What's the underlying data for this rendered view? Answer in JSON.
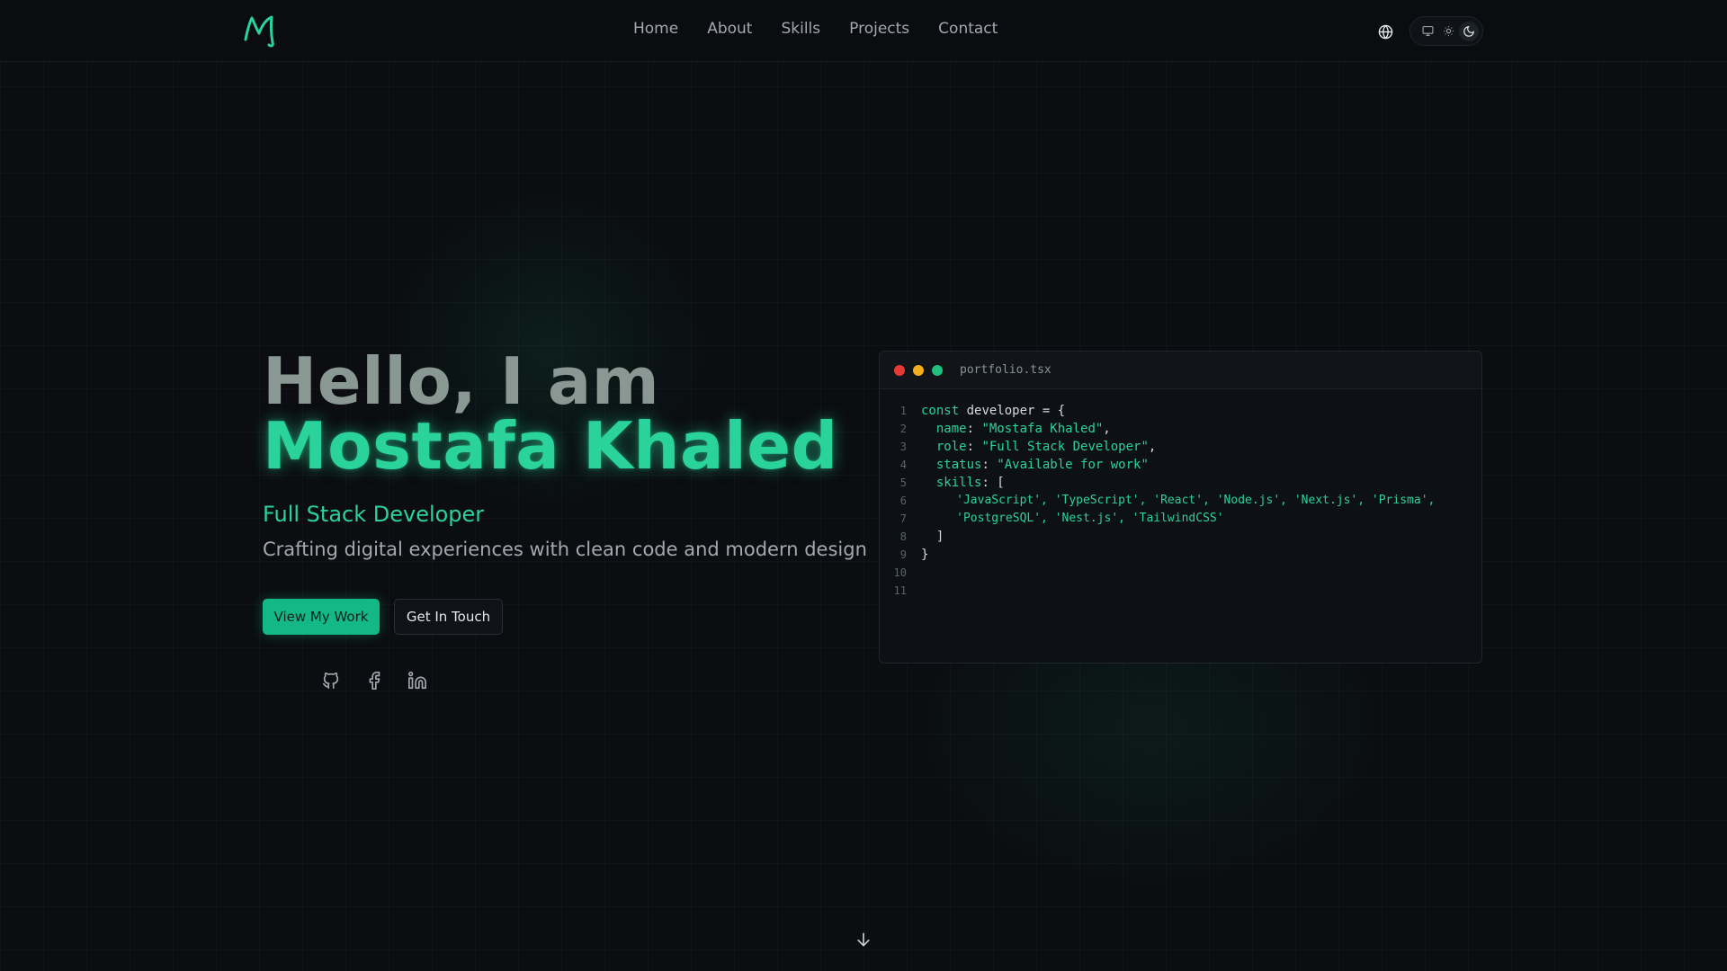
{
  "nav": {
    "links": [
      "Home",
      "About",
      "Skills",
      "Projects",
      "Contact"
    ]
  },
  "hero": {
    "greeting": "Hello, I am",
    "name": "Mostafa Khaled",
    "role": "Full Stack Developer",
    "tagline": "Crafting digital experiences with clean code and modern design",
    "primary_button": "View My Work",
    "secondary_button": "Get In Touch"
  },
  "socials": [
    "github-icon",
    "facebook-icon",
    "linkedin-icon"
  ],
  "code": {
    "filename": "portfolio.tsx",
    "line_numbers": [
      "1",
      "2",
      "3",
      "4",
      "5",
      "6",
      "7",
      "8",
      "9",
      "10",
      "11"
    ],
    "kw_const": "const",
    "var_name": " developer = {",
    "name_key": "  name",
    "name_val": "\"Mostafa Khaled\"",
    "role_key": "  role",
    "role_val": "\"Full Stack Developer\"",
    "status_key": "  status",
    "status_val": "\"Available for work\"",
    "skills_key": "  skills",
    "skills_open": ": [",
    "skills_line1": "     'JavaScript', 'TypeScript', 'React', 'Node.js', 'Next.js', 'Prisma',",
    "skills_line2": "     'PostgreSQL', 'Nest.js', 'TailwindCSS'",
    "skills_close": "  ]",
    "obj_close": "}"
  },
  "colors": {
    "accent": "#2ad39a",
    "background": "#0b0d10",
    "muted_heading": "#8a9893"
  }
}
